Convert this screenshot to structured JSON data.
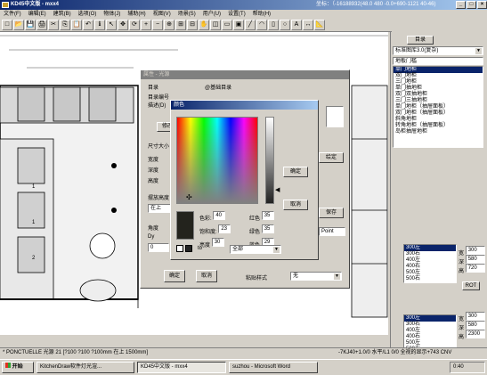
{
  "app": {
    "title": "KD45中文版 - mxx4",
    "coords": "坐标：（-16188932(48.0 480 -0.0+690-1121 40-46)"
  },
  "menu": [
    "文件(F)",
    "编辑(E)",
    "建筑(B)",
    "选项(O)",
    "物体(J)",
    "辅助(H)",
    "视图(V)",
    "场景(S)",
    "用户(U)",
    "设置(T)",
    "帮助(H)"
  ],
  "toolbar_icons": [
    "new-icon",
    "open-icon",
    "save-icon",
    "print-icon",
    "cut-icon",
    "copy-icon",
    "paste-icon",
    "undo-icon",
    "info-icon",
    "select-icon",
    "move-icon",
    "rotate-icon",
    "zoom-in-icon",
    "zoom-out-icon",
    "zoom-window-icon",
    "zoom-all-icon",
    "zoom-prev-icon",
    "pan-icon",
    "view-icon",
    "frame-icon",
    "render-icon",
    "line-icon",
    "arc-icon",
    "rect-icon",
    "circle-icon",
    "text-icon",
    "dimension-icon",
    "measure-icon"
  ],
  "toolbar_glyphs": [
    "□",
    "📂",
    "💾",
    "🖨",
    "✂",
    "⎘",
    "📋",
    "↶",
    "ℹ",
    "↖",
    "✥",
    "⟳",
    "+",
    "−",
    "⊕",
    "⊞",
    "⊟",
    "✋",
    "◫",
    "▭",
    "▣",
    "╱",
    "◠",
    "▯",
    "○",
    "A",
    "↔",
    "📐"
  ],
  "canvas": {
    "light_label": "P"
  },
  "right_panel": {
    "tab": "目录",
    "library": "标准图库3.0(复杂)",
    "category": "地板门槛",
    "items": [
      "单门地柜",
      "双门地柜",
      "三门地柜",
      "单门抽地柜",
      "双门双抽地柜",
      "三门三抽地柜",
      "单门地柜（抽屉面板）",
      "双门地柜（抽屉面板）",
      "斜角地柜",
      "转角地柜（抽屉面板）",
      "岛柜抽屉地柜"
    ],
    "sizes_1": [
      "300左",
      "300右",
      "400左",
      "400右",
      "500左",
      "500右"
    ],
    "sizes_2": [
      "300左",
      "300右",
      "400左",
      "400右",
      "500左",
      "500右"
    ],
    "dims": {
      "w_label": "宽",
      "w": "300",
      "d_label": "深",
      "d": "580",
      "h_label": "高",
      "h": "720"
    },
    "dims2": {
      "w_label": "宽",
      "w": "300",
      "d_label": "深",
      "d": "580",
      "h_label": "高",
      "h": "2300"
    },
    "rot": "ROT"
  },
  "prop_dialog": {
    "title": "属性 - 光源",
    "catalog_label": "目录",
    "catalog_value": "@基础目录",
    "catalog_no_label": "目录编号",
    "desc_label": "描述(D)",
    "btn_modify": "修改",
    "size_label": "尺寸大小",
    "width_label": "宽度",
    "depth_label": "深度",
    "height_label": "高度",
    "place_label": "摆放高度",
    "place_value": "在上",
    "angle_label": "角度",
    "dy_label": "Dy",
    "dy_value": "0",
    "btn_ok": "确定",
    "btn_cancel": "取消",
    "paste_label": "粘贴样式",
    "paste_value": "无",
    "btn_side": "绘定",
    "btn_side2": "保存",
    "unit_value": "Point"
  },
  "color_dialog": {
    "title": "颜色",
    "hue_label": "色彩:",
    "hue": "40",
    "sat_label": "饱和度:",
    "sat": "23",
    "lum_label": "亮度",
    "lum": "30",
    "red_label": "红色",
    "red": "35",
    "green_label": "绿色",
    "green": "35",
    "blue_label": "蓝色",
    "blue": "29",
    "btn_ok": "确定",
    "btn_cancel": "取消",
    "to_label": "to",
    "range_value": "全部"
  },
  "status": {
    "left": "* PONCTUELLE 光源 21 [?100 ?100 ?100mm 在上 1500mm]",
    "right": "-7KJ40+1.0/0 水平/L1 0/0 全视的显示+743 CNV"
  },
  "taskbar": {
    "start": "开始",
    "tasks": [
      "KitchenDraw软件灯光渲...",
      "KD45中文版 - mxx4",
      "suzhou - Microsoft Word"
    ],
    "clock": "0:40"
  }
}
